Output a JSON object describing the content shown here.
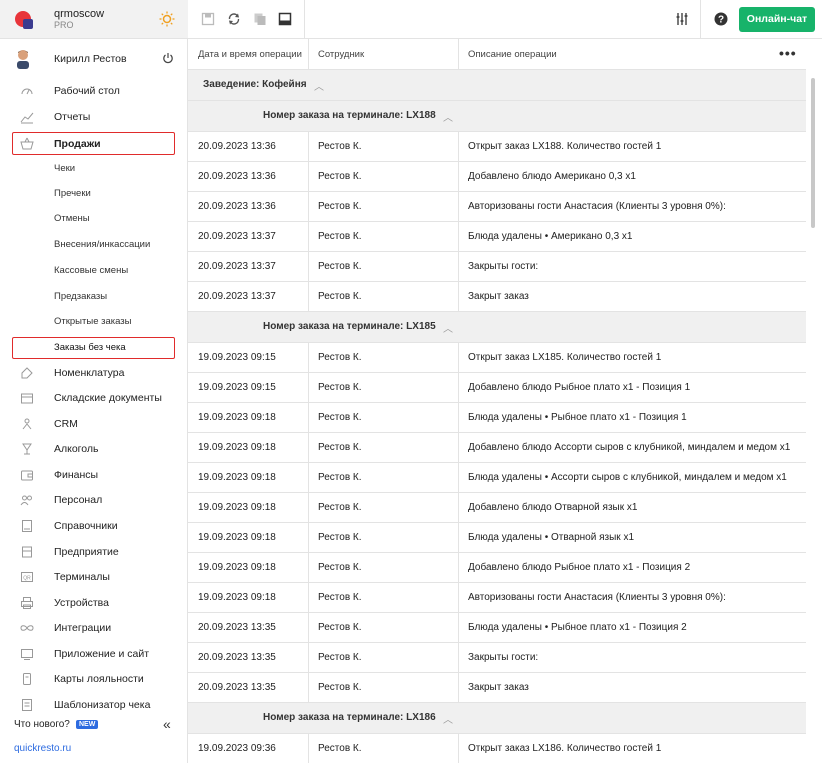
{
  "brand": {
    "name": "qrmoscow",
    "plan": "PRO"
  },
  "user": {
    "name": "Кирилл Рестов"
  },
  "sidebar": {
    "items": [
      {
        "label": "Рабочий стол",
        "icon": "dashboard-icon"
      },
      {
        "label": "Отчеты",
        "icon": "chart-icon"
      },
      {
        "label": "Продажи",
        "icon": "basket-icon"
      }
    ],
    "sales_sub": [
      {
        "label": "Чеки"
      },
      {
        "label": "Пречеки"
      },
      {
        "label": "Отмены"
      },
      {
        "label": "Внесения/инкассации"
      },
      {
        "label": "Кассовые смены"
      },
      {
        "label": "Предзаказы"
      },
      {
        "label": "Открытые заказы"
      },
      {
        "label": "Заказы без чека"
      }
    ],
    "items_after": [
      {
        "label": "Номенклатура",
        "icon": "tag-icon"
      },
      {
        "label": "Складские документы",
        "icon": "warehouse-icon"
      },
      {
        "label": "CRM",
        "icon": "people-icon"
      },
      {
        "label": "Алкоголь",
        "icon": "glass-icon"
      },
      {
        "label": "Финансы",
        "icon": "wallet-icon"
      },
      {
        "label": "Персонал",
        "icon": "staff-icon"
      },
      {
        "label": "Справочники",
        "icon": "book-icon"
      },
      {
        "label": "Предприятие",
        "icon": "building-icon"
      },
      {
        "label": "Терминалы",
        "icon": "terminal-icon"
      },
      {
        "label": "Устройства",
        "icon": "printer-icon"
      },
      {
        "label": "Интеграции",
        "icon": "infinity-icon"
      },
      {
        "label": "Приложение и сайт",
        "icon": "app-icon"
      },
      {
        "label": "Карты лояльности",
        "icon": "card-icon"
      },
      {
        "label": "Шаблонизатор чека",
        "icon": "receipt-icon"
      }
    ],
    "whats_new": "Что нового?",
    "new_badge": "NEW",
    "site": "quickresto.ru"
  },
  "toolbar": {
    "chat_label": "Онлайн-чат"
  },
  "table": {
    "columns": [
      "Дата и время операции",
      "Сотрудник",
      "Описание операции"
    ],
    "venue_group": "Заведение: Кофейня",
    "groups": [
      {
        "title": "Номер заказа на терминале: LX188",
        "rows": [
          [
            "20.09.2023 13:36",
            "Рестов К.",
            "Открыт заказ LX188. Количество гостей 1"
          ],
          [
            "20.09.2023 13:36",
            "Рестов К.",
            "Добавлено блюдо Американо 0,3 x1"
          ],
          [
            "20.09.2023 13:36",
            "Рестов К.",
            "Авторизованы гости Анастасия (Клиенты 3 уровня 0%):"
          ],
          [
            "20.09.2023 13:37",
            "Рестов К.",
            "Блюда удалены • Американо 0,3 x1"
          ],
          [
            "20.09.2023 13:37",
            "Рестов К.",
            "Закрыты гости:"
          ],
          [
            "20.09.2023 13:37",
            "Рестов К.",
            "Закрыт заказ"
          ]
        ]
      },
      {
        "title": "Номер заказа на терминале: LX185",
        "rows": [
          [
            "19.09.2023 09:15",
            "Рестов К.",
            "Открыт заказ LX185. Количество гостей 1"
          ],
          [
            "19.09.2023 09:15",
            "Рестов К.",
            "Добавлено блюдо Рыбное плато x1 - Позиция 1"
          ],
          [
            "19.09.2023 09:18",
            "Рестов К.",
            "Блюда удалены • Рыбное плато x1 - Позиция 1"
          ],
          [
            "19.09.2023 09:18",
            "Рестов К.",
            "Добавлено блюдо Ассорти сыров с клубникой, миндалем и медом x1"
          ],
          [
            "19.09.2023 09:18",
            "Рестов К.",
            "Блюда удалены • Ассорти сыров с клубникой, миндалем и медом x1"
          ],
          [
            "19.09.2023 09:18",
            "Рестов К.",
            "Добавлено блюдо Отварной язык x1"
          ],
          [
            "19.09.2023 09:18",
            "Рестов К.",
            "Блюда удалены • Отварной язык x1"
          ],
          [
            "19.09.2023 09:18",
            "Рестов К.",
            "Добавлено блюдо Рыбное плато x1 - Позиция 2"
          ],
          [
            "19.09.2023 09:18",
            "Рестов К.",
            "Авторизованы гости Анастасия (Клиенты 3 уровня 0%):"
          ],
          [
            "20.09.2023 13:35",
            "Рестов К.",
            "Блюда удалены • Рыбное плато x1 - Позиция 2"
          ],
          [
            "20.09.2023 13:35",
            "Рестов К.",
            "Закрыты гости:"
          ],
          [
            "20.09.2023 13:35",
            "Рестов К.",
            "Закрыт заказ"
          ]
        ]
      },
      {
        "title": "Номер заказа на терминале: LX186",
        "rows": [
          [
            "19.09.2023 09:36",
            "Рестов К.",
            "Открыт заказ LX186. Количество гостей 1"
          ]
        ]
      }
    ]
  },
  "colors": {
    "accent_green": "#17b36a",
    "highlight_red": "#e02b2b",
    "link_blue": "#2d6be0"
  }
}
